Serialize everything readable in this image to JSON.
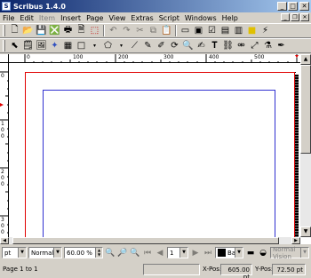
{
  "window": {
    "title": "Scribus 1.4.0",
    "app_icon": "S"
  },
  "menu": [
    {
      "label": "File",
      "disabled": false
    },
    {
      "label": "Edit",
      "disabled": false
    },
    {
      "label": "Item",
      "disabled": true
    },
    {
      "label": "Insert",
      "disabled": false
    },
    {
      "label": "Page",
      "disabled": false
    },
    {
      "label": "View",
      "disabled": false
    },
    {
      "label": "Extras",
      "disabled": false
    },
    {
      "label": "Script",
      "disabled": false
    },
    {
      "label": "Windows",
      "disabled": false
    },
    {
      "label": "Help",
      "disabled": false
    }
  ],
  "ruler": {
    "h_labels": [
      "0",
      "100",
      "200",
      "300",
      "400",
      "500"
    ],
    "v_labels": [
      "0",
      "1\n0\n0",
      "2\n0\n0",
      "3\n0\n0"
    ]
  },
  "bottom": {
    "unit": "pt",
    "render_mode": "Normal",
    "zoom": "60.00 %",
    "page_number": "1",
    "layer": "Back",
    "vision": "Normal Vision"
  },
  "status": {
    "page_info": "Page 1 to 1",
    "x_label": "X-Pos:",
    "x_value": "605.00 pt",
    "y_label": "Y-Pos:",
    "y_value": "72.50 pt"
  },
  "colors": {
    "bleed": "#e00000",
    "margins": "#3030d0",
    "titlebar": "#0a246a"
  }
}
